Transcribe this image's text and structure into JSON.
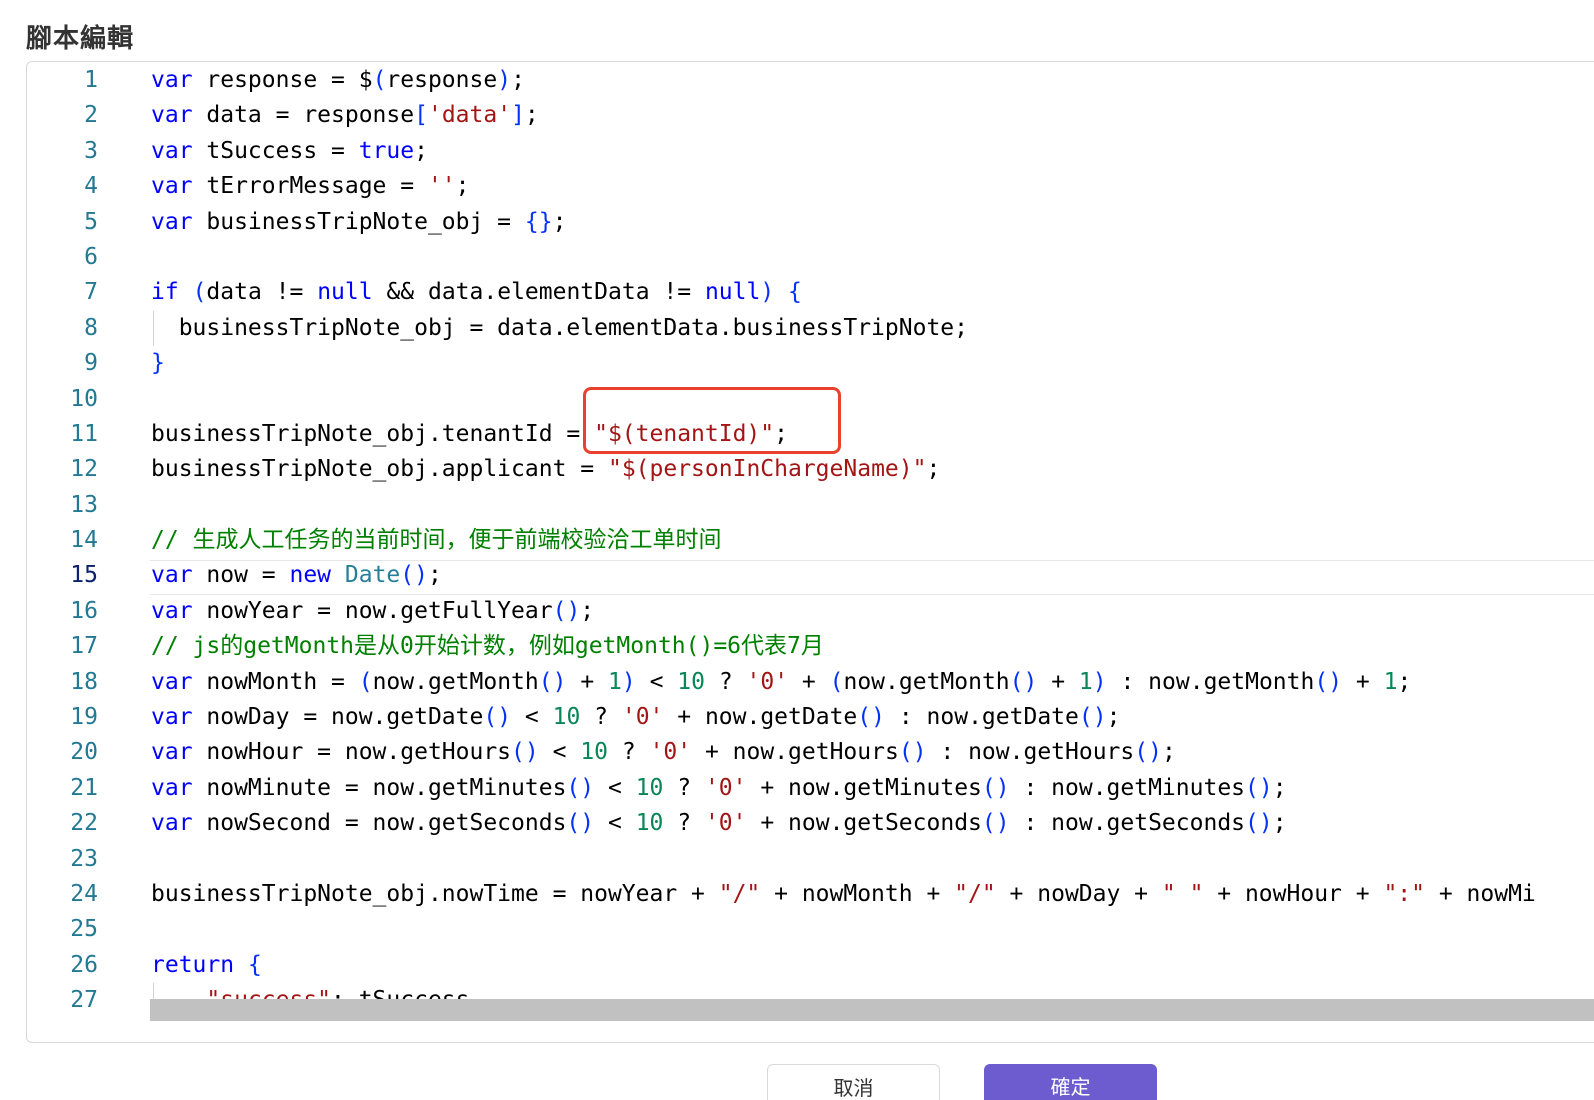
{
  "section_title": "腳本編輯",
  "active_line": 15,
  "code_lines": [
    "var response = $(response);",
    "var data = response['data'];",
    "var tSuccess = true;",
    "var tErrorMessage = '';",
    "var businessTripNote_obj = {};",
    "",
    "if (data != null && data.elementData != null) {",
    "  businessTripNote_obj = data.elementData.businessTripNote;",
    "}",
    "",
    "businessTripNote_obj.tenantId = \"$(tenantId)\";",
    "businessTripNote_obj.applicant = \"$(personInChargeName)\";",
    "",
    "// 生成人工任务的当前时间，便于前端校验洽工单时间",
    "var now = new Date();",
    "var nowYear = now.getFullYear();",
    "// js的getMonth是从0开始计数，例如getMonth()=6代表7月",
    "var nowMonth = (now.getMonth() + 1) < 10 ? '0' + (now.getMonth() + 1) : now.getMonth() + 1;",
    "var nowDay = now.getDate() < 10 ? '0' + now.getDate() : now.getDate();",
    "var nowHour = now.getHours() < 10 ? '0' + now.getHours() : now.getHours();",
    "var nowMinute = now.getMinutes() < 10 ? '0' + now.getMinutes() : now.getMinutes();",
    "var nowSecond = now.getSeconds() < 10 ? '0' + now.getSeconds() : now.getSeconds();",
    "",
    "businessTripNote_obj.nowTime = nowYear + \"/\" + nowMonth + \"/\" + nowDay + \" \" + nowHour + \":\" + nowMi",
    "",
    "return {",
    "    \"success\": tSuccess,"
  ],
  "colors": {
    "keyword": "#0000ff",
    "string": "#a31515",
    "number": "#098658",
    "comment": "#008000",
    "line_number": "#237893",
    "annotation": "#e8412c",
    "primary_button": "#6d5bd0"
  },
  "buttons": {
    "cancel_label": "取消",
    "ok_label": "確定"
  }
}
